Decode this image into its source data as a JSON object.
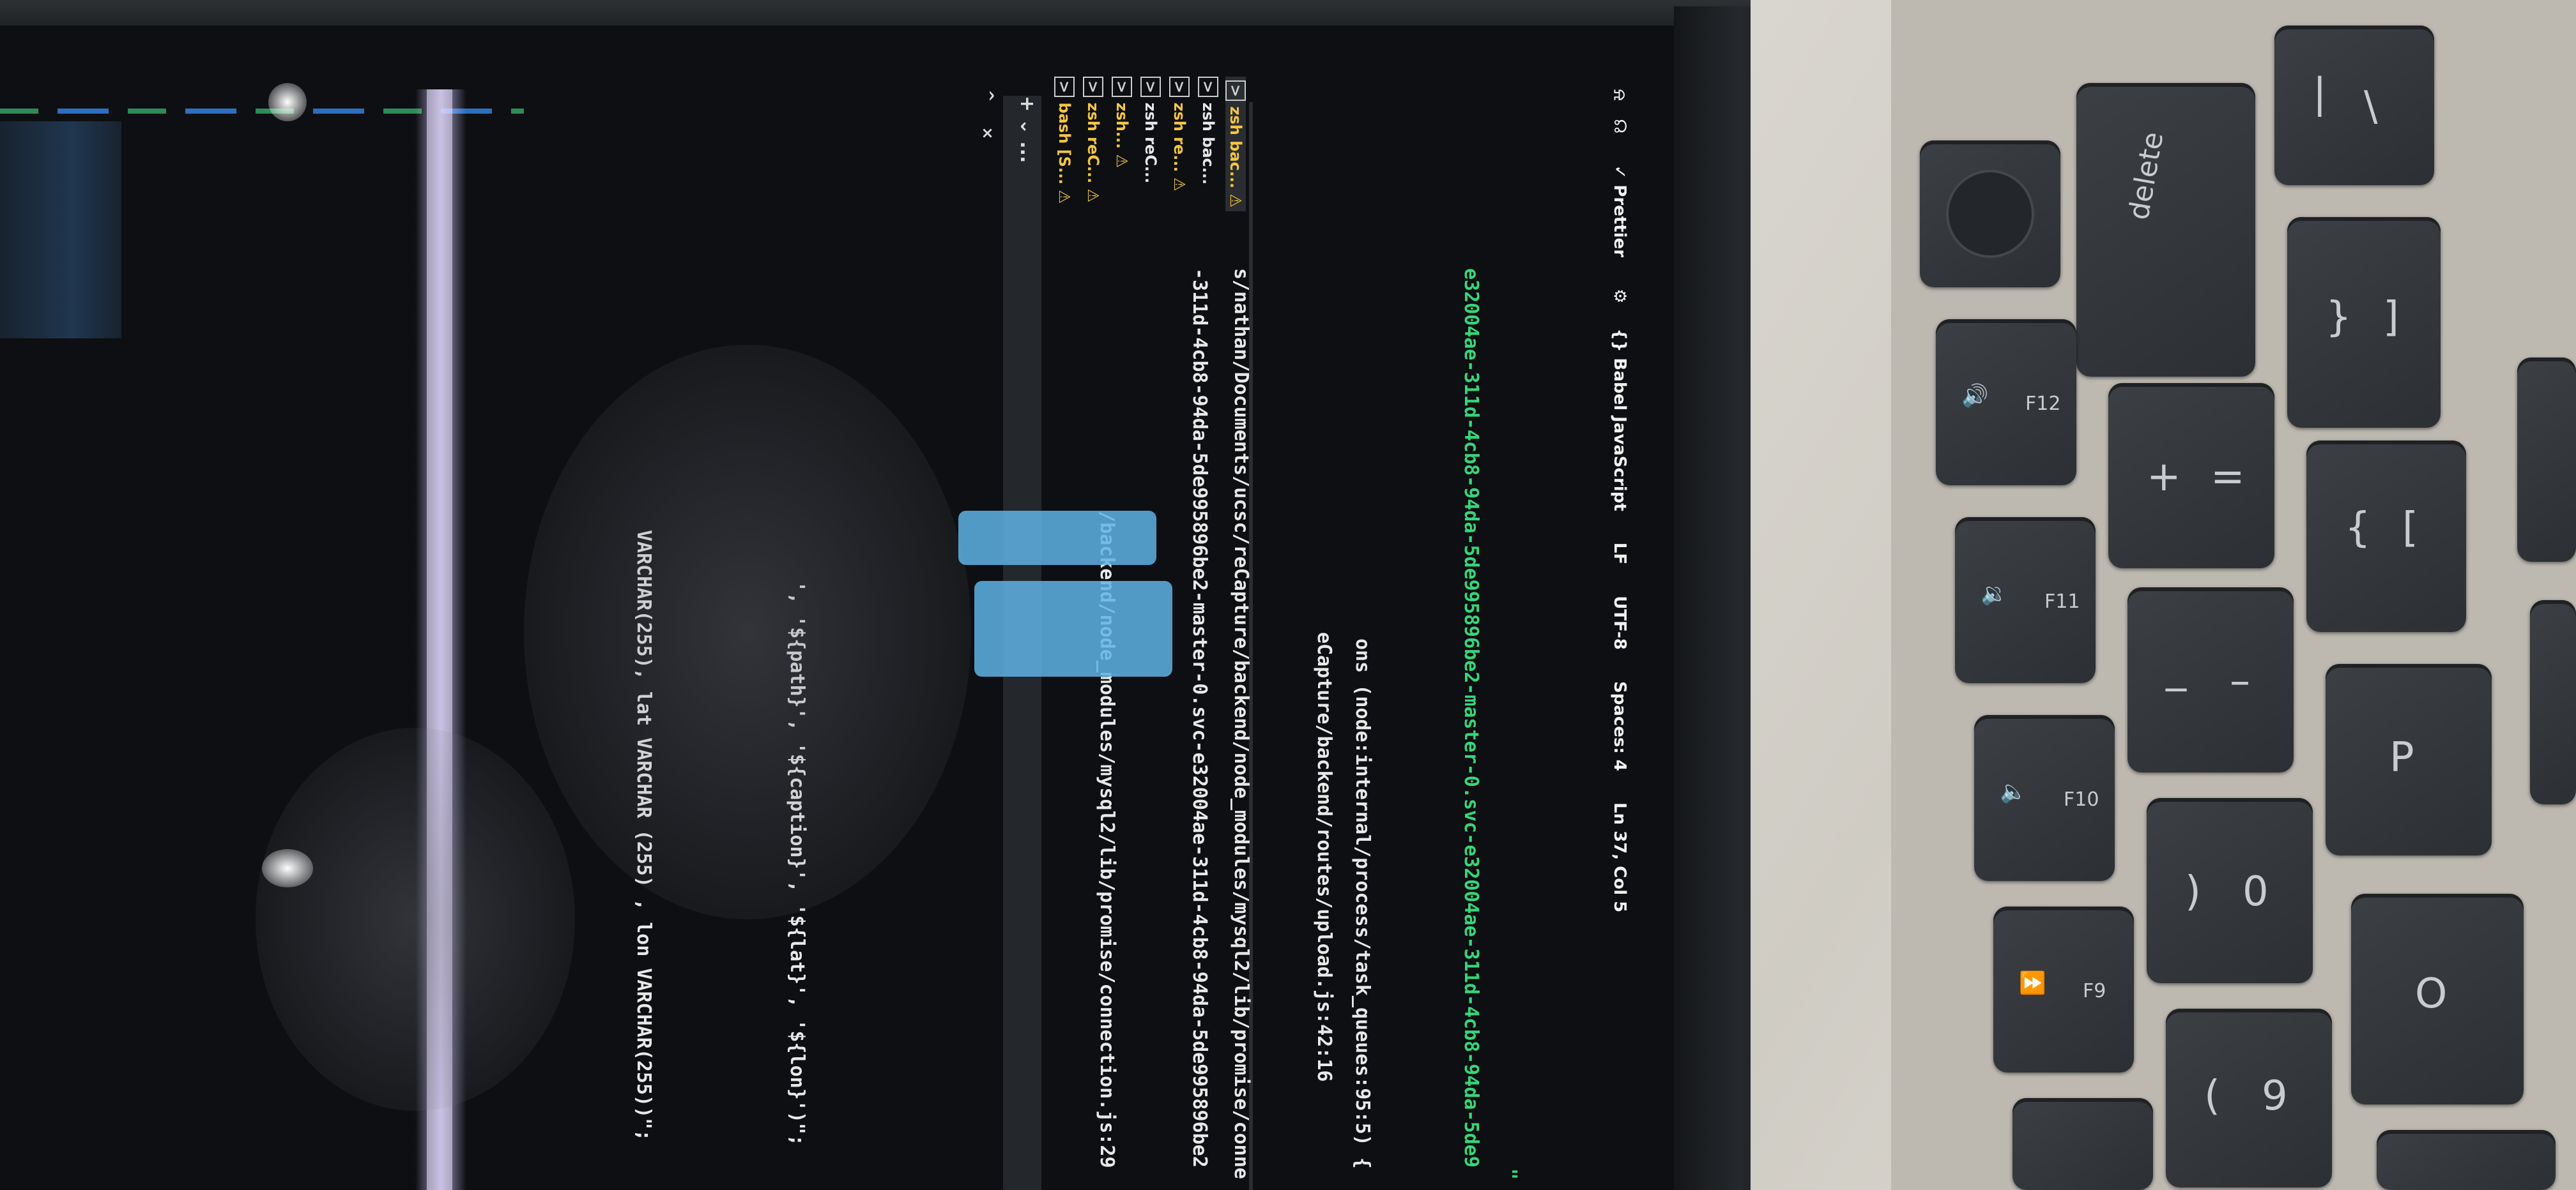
{
  "editor": {
    "code_lines": [
      "VARCHAR(255), lat VARCHAR (255) , lon VARCHAR(255))\";",
      "', '${path}', '${caption}', '${lat}', '${lon}')\";"
    ]
  },
  "terminal": {
    "lines": [
      "/backend/node_modules/mysql2/lib/promise/connection.js:29",
      "-311d-4cb8-94da-5de995896be2-master-0.svc-e32004ae-311d-4cb8-94da-5de995896be2",
      "s/nathan/Documents/ucsc/reCapture/backend/node_modules/mysql2/lib/promise/conne",
      "eCapture/backend/routes/upload.js:42:16",
      "ons (node:internal/process/task_queues:95:5) {",
      "e32004ae-311d-4cb8-94da-5de995896be2-master-0.svc-e32004ae-311d-4cb8-94da-5de9",
      "\""
    ],
    "tabs": [
      {
        "label": "bash [S...",
        "warn": "⚠"
      },
      {
        "label": "zsh reC...",
        "warn": "⚠"
      },
      {
        "label": "zsh...",
        "warn": "⚠"
      },
      {
        "label": "zsh reC...",
        "warn": ""
      },
      {
        "label": "zsh re...",
        "warn": "⚠"
      },
      {
        "label": "zsh bac...",
        "warn": ""
      },
      {
        "label": "zsh bac...",
        "warn": "⚠"
      }
    ],
    "controls": {
      "plus": "+",
      "chevron": "⌄",
      "more": "...",
      "close": "×",
      "caret": "^"
    }
  },
  "status_bar": {
    "position": "Ln 37, Col 5",
    "spaces": "Spaces: 4",
    "encoding": "UTF-8",
    "eol": "LF",
    "language": "{} Babel JavaScript",
    "prettier": "✓ Prettier"
  },
  "keyboard": {
    "delete": "delete",
    "f12": "F12",
    "f11": "F11",
    "f10": "F10",
    "f9": "F9",
    "plus_top": "+",
    "plus_bottom": "=",
    "minus_top": "_",
    "minus_bottom": "–",
    "zero_top": ")",
    "zero_bottom": "0",
    "nine_top": "(",
    "nine_bottom": "9",
    "brace_open_top": "{",
    "brace_open_bottom": "[",
    "brace_close_top": "}",
    "brace_close_bottom": "]",
    "pipe_top": "|",
    "pipe_bottom": "\\",
    "p": "P",
    "o": "O"
  }
}
